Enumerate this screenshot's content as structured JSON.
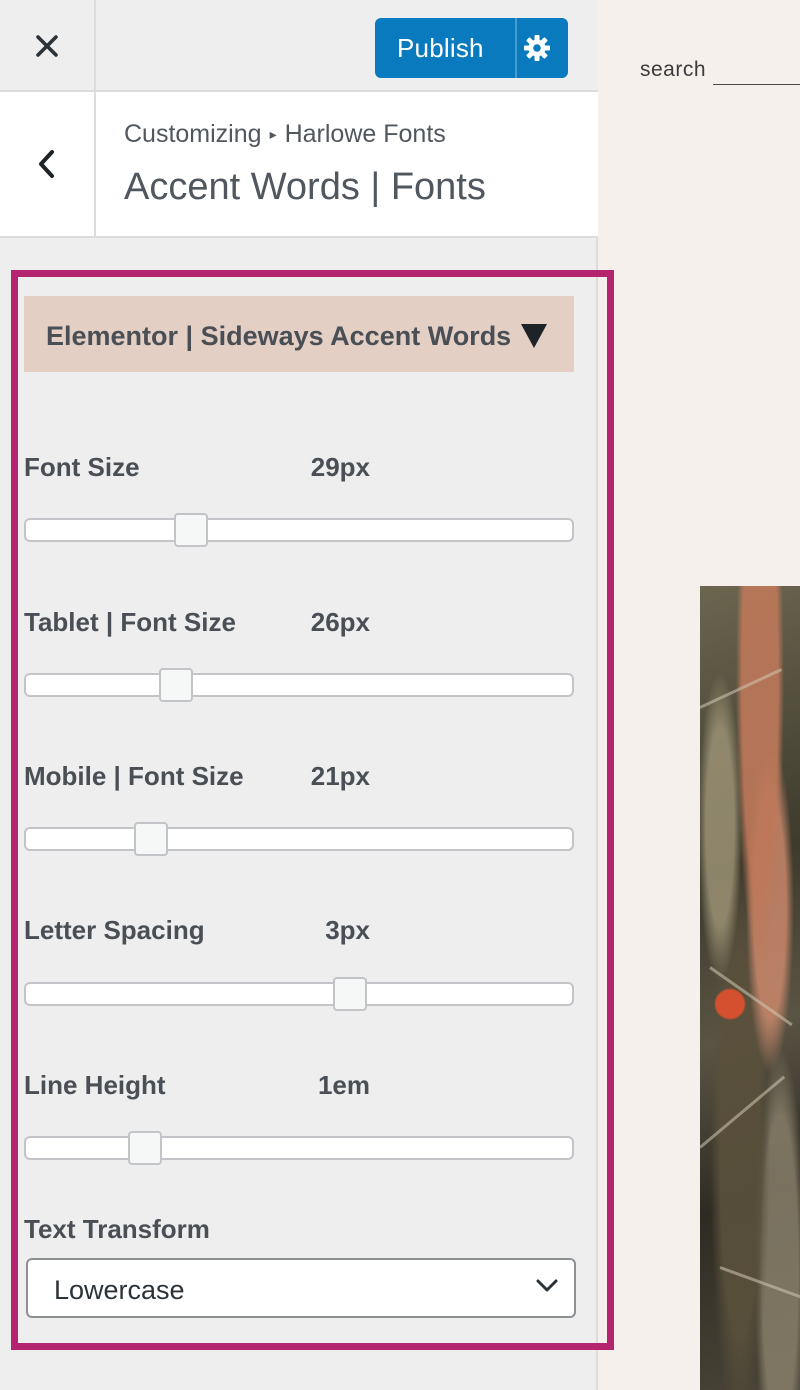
{
  "topbar": {
    "close_icon": "close-icon",
    "publish_label": "Publish",
    "settings_icon": "gear-icon",
    "accent_color": "#0a7abf"
  },
  "header": {
    "back_icon": "chevron-left-icon",
    "breadcrumb_root": "Customizing",
    "breadcrumb_separator": "▸",
    "breadcrumb_current": "Harlowe Fonts",
    "title": "Accent Words | Fonts"
  },
  "section": {
    "title": "Elementor | Sideways Accent Words",
    "toggle_icon": "triangle-down-icon",
    "highlight_color": "#b5246f",
    "background_color": "#e4cfc5"
  },
  "controls": [
    {
      "label": "Font Size",
      "value": "29px",
      "level": 0.29
    },
    {
      "label": "Tablet | Font Size",
      "value": "26px",
      "level": 0.26
    },
    {
      "label": "Mobile | Font Size",
      "value": "21px",
      "level": 0.21
    },
    {
      "label": "Letter Spacing",
      "value": "3px",
      "level": 0.6
    },
    {
      "label": "Line Height",
      "value": "1em",
      "level": 0.2
    }
  ],
  "text_transform": {
    "label": "Text Transform",
    "selected": "Lowercase"
  },
  "preview": {
    "search_label": "search"
  }
}
